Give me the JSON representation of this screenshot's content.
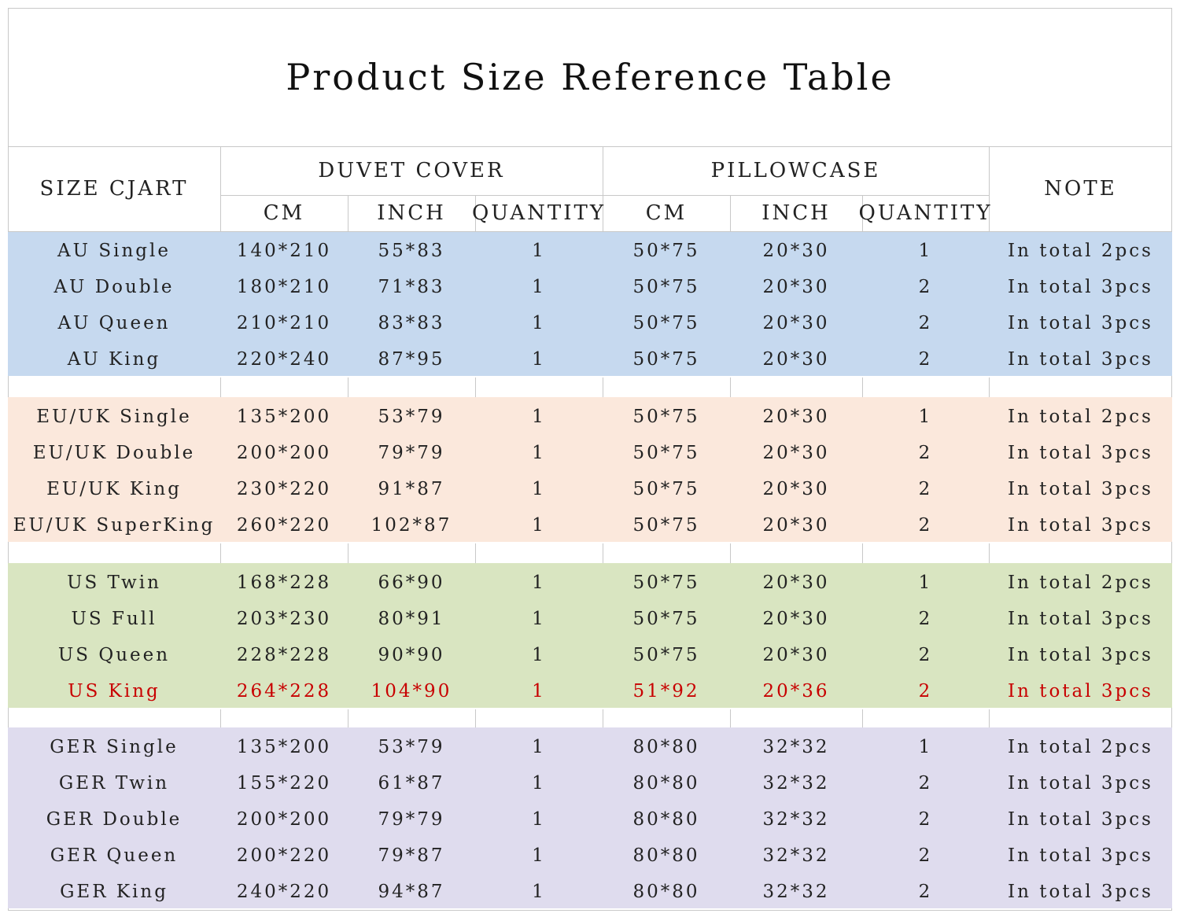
{
  "title": "Product Size Reference Table",
  "header": {
    "size_chart": "SIZE CJART",
    "duvet_cover": "DUVET COVER",
    "pillowcase": "PILLOWCASE",
    "note": "NOTE",
    "sub": [
      "CM",
      "INCH",
      "QUANTITY",
      "CM",
      "INCH",
      "QUANTITY"
    ]
  },
  "colors": {
    "au": "#c6d9ef",
    "eu_uk": "#fbe8dc",
    "us": "#d9e5c1",
    "ger": "#dfdcee",
    "highlight_text": "#c80000",
    "grid": "#c8c8c8"
  },
  "groups": [
    {
      "key": "au",
      "rows": [
        [
          "AU Single",
          "140*210",
          "55*83",
          "1",
          "50*75",
          "20*30",
          "1",
          "In total 2pcs"
        ],
        [
          "AU Double",
          "180*210",
          "71*83",
          "1",
          "50*75",
          "20*30",
          "2",
          "In total 3pcs"
        ],
        [
          "AU Queen",
          "210*210",
          "83*83",
          "1",
          "50*75",
          "20*30",
          "2",
          "In total 3pcs"
        ],
        [
          "AU King",
          "220*240",
          "87*95",
          "1",
          "50*75",
          "20*30",
          "2",
          "In total 3pcs"
        ]
      ]
    },
    {
      "key": "eu_uk",
      "rows": [
        [
          "EU/UK Single",
          "135*200",
          "53*79",
          "1",
          "50*75",
          "20*30",
          "1",
          "In total 2pcs"
        ],
        [
          "EU/UK Double",
          "200*200",
          "79*79",
          "1",
          "50*75",
          "20*30",
          "2",
          "In total 3pcs"
        ],
        [
          "EU/UK King",
          "230*220",
          "91*87",
          "1",
          "50*75",
          "20*30",
          "2",
          "In total 3pcs"
        ],
        [
          "EU/UK SuperKing",
          "260*220",
          "102*87",
          "1",
          "50*75",
          "20*30",
          "2",
          "In total 3pcs"
        ]
      ]
    },
    {
      "key": "us",
      "rows": [
        [
          "US Twin",
          "168*228",
          "66*90",
          "1",
          "50*75",
          "20*30",
          "1",
          "In total 2pcs"
        ],
        [
          "US Full",
          "203*230",
          "80*91",
          "1",
          "50*75",
          "20*30",
          "2",
          "In total 3pcs"
        ],
        [
          "US Queen",
          "228*228",
          "90*90",
          "1",
          "50*75",
          "20*30",
          "2",
          "In total 3pcs"
        ],
        [
          "US King",
          "264*228",
          "104*90",
          "1",
          "51*92",
          "20*36",
          "2",
          "In total 3pcs"
        ]
      ],
      "highlight_row": 3
    },
    {
      "key": "ger",
      "rows": [
        [
          "GER Single",
          "135*200",
          "53*79",
          "1",
          "80*80",
          "32*32",
          "1",
          "In total 2pcs"
        ],
        [
          "GER Twin",
          "155*220",
          "61*87",
          "1",
          "80*80",
          "32*32",
          "2",
          "In total 3pcs"
        ],
        [
          "GER Double",
          "200*200",
          "79*79",
          "1",
          "80*80",
          "32*32",
          "2",
          "In total 3pcs"
        ],
        [
          "GER Queen",
          "200*220",
          "79*87",
          "1",
          "80*80",
          "32*32",
          "2",
          "In total 3pcs"
        ],
        [
          "GER King",
          "240*220",
          "94*87",
          "1",
          "80*80",
          "32*32",
          "2",
          "In total 3pcs"
        ]
      ]
    }
  ]
}
